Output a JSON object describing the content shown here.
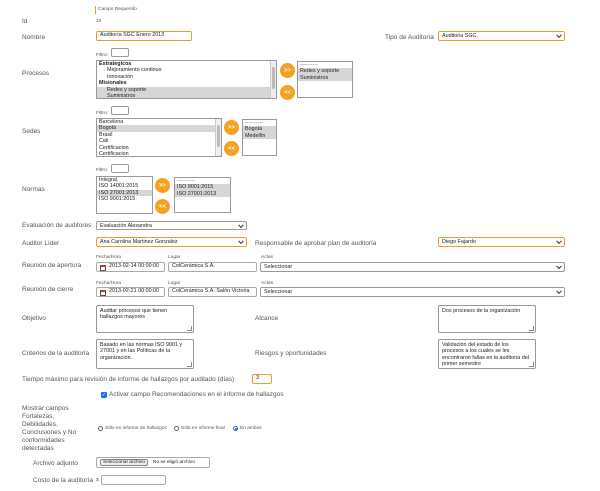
{
  "legend": {
    "required": "Campo Requerido"
  },
  "id": {
    "label": "Id",
    "value": "23"
  },
  "nombre": {
    "label": "Nombre",
    "value": "Auditoría SGC Enero 2013"
  },
  "tipo": {
    "label": "Tipo de Auditoría",
    "value": "Auditoria SGC."
  },
  "filtro": "Filtro:",
  "procesos": {
    "label": "Procesos",
    "available": [
      {
        "text": "Estrategicos",
        "kind": "grp"
      },
      {
        "text": "Mejoramiento continuo",
        "kind": "ind"
      },
      {
        "text": "Innovación",
        "kind": "ind"
      },
      {
        "text": "Misionales",
        "kind": "grp"
      },
      {
        "text": "Redes y soporte",
        "kind": "ind sel-on"
      },
      {
        "text": "Suministros",
        "kind": "ind sel-on"
      }
    ],
    "selected": [
      {
        "text": "----------",
        "kind": "dash"
      },
      {
        "text": "Redes y soporte",
        "kind": "sel-on"
      },
      {
        "text": "Suministros",
        "kind": "sel-on"
      }
    ]
  },
  "sedes": {
    "label": "Sedes",
    "available": [
      {
        "text": "Barcelona",
        "kind": ""
      },
      {
        "text": "Bogotá",
        "kind": "sel-on"
      },
      {
        "text": "Brasil",
        "kind": ""
      },
      {
        "text": "Cali",
        "kind": ""
      },
      {
        "text": "Certificacion",
        "kind": ""
      },
      {
        "text": "Certificacion",
        "kind": ""
      }
    ],
    "selected": [
      {
        "text": "----------",
        "kind": "dash"
      },
      {
        "text": "Bogotá",
        "kind": "sel-on"
      },
      {
        "text": "Medellín",
        "kind": "sel-on"
      }
    ]
  },
  "normas": {
    "label": "Normas",
    "available": [
      {
        "text": "Integral.",
        "kind": ""
      },
      {
        "text": "ISO 14001:2015",
        "kind": ""
      },
      {
        "text": "ISO 27001:2013",
        "kind": "sel-on"
      },
      {
        "text": "ISO 9001:2015",
        "kind": ""
      }
    ],
    "selected": [
      {
        "text": "----------",
        "kind": "dash"
      },
      {
        "text": "ISO 9001:2015",
        "kind": "sel-on"
      },
      {
        "text": "ISO 27001:2013",
        "kind": "sel-on"
      }
    ]
  },
  "buttons": {
    "add": ">>",
    "remove": "<<"
  },
  "evaluacion": {
    "label": "Evaluación de auditores",
    "value": "Evaluación Alexandra"
  },
  "lider": {
    "label": "Auditor Líder",
    "value": "Ana Carolina Martinez Gonzalez"
  },
  "responsable": {
    "label": "Responsable de aprobar plan de auditoría",
    "value": "Diego Fajardo"
  },
  "col_labels": {
    "fecha": "Fecha/Hora",
    "lugar": "Lugar",
    "actas": "Actas"
  },
  "apertura": {
    "label": "Reunión de apertura",
    "fecha": "2013-02-14 00:00:00",
    "lugar": "ColCerámica S.A.",
    "actas": "Seleccionar"
  },
  "cierre": {
    "label": "Reunión de cierre",
    "fecha": "2013-02-21 00:00:00",
    "lugar": "ColCerámica S.A. Salón Victoria",
    "actas": "Seleccionar"
  },
  "objetivo": {
    "label": "Objetivo",
    "value": "Auditar procesos que tienen hallazgos mayores"
  },
  "alcance": {
    "label": "Alcance",
    "value": "Dos procesos de la organización"
  },
  "criterios": {
    "label": "Criterios de la auditoría",
    "value": "Basado en las normas ISO 9001 y 27001 y en las Políticas de la organización."
  },
  "riesgos": {
    "label": "Riesgos y oportunidades",
    "value": "Validación del estado de los procesos a los cuales se les encontraron fallas en la auditoria del primer semestre"
  },
  "tiempo": {
    "label": "Tiempo máximo para revisión de informe de hallazgos por auditado (días)",
    "value": "3"
  },
  "recomendaciones": {
    "label": "Activar campo Recomendaciones en el informe de hallazgos",
    "checked": true
  },
  "mostrar": {
    "label_lines": [
      "Mostrar campos",
      "Fortalezas,",
      "Debilidades,",
      "Conclusiones y No",
      "conformidades",
      "detectadas"
    ],
    "options": [
      "Sólo en informe de hallazgos",
      "Sólo en informe final",
      "En ambos"
    ],
    "selected_index": 2
  },
  "archivo": {
    "label": "Archivo adjunto",
    "button": "Seleccionar archivo",
    "status": "No se eligió archivo"
  },
  "costo": {
    "label": "Costo de la auditoría",
    "currency": "$",
    "value": ""
  },
  "colors": {
    "accent": "#f6a120",
    "required_border": "#f39a2c",
    "checkbox": "#1a73e8"
  }
}
